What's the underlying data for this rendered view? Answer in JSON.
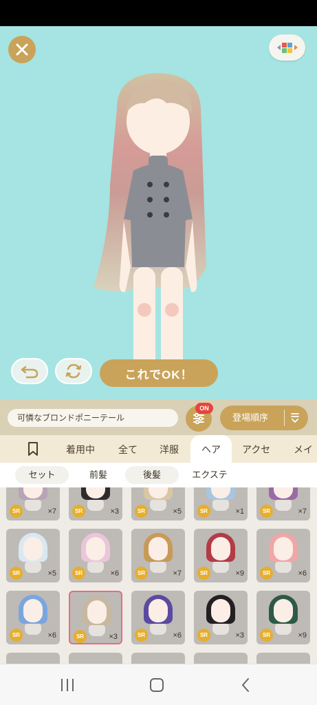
{
  "buttons": {
    "ok_label": "これでOK！"
  },
  "item_name": "可憐なブロンドポニーテール",
  "filter_badge": "ON",
  "sort_label": "登場順序",
  "tabs": [
    "着用中",
    "全て",
    "洋服",
    "ヘア",
    "アクセ",
    "メイ"
  ],
  "active_tab": "ヘア",
  "subtabs": [
    "セット",
    "前髪",
    "後髪",
    "エクステ"
  ],
  "items": [
    {
      "rarity": "SR",
      "qty": "×7",
      "hair": "#b9a3b6",
      "icon": "hair-item-icon"
    },
    {
      "rarity": "SR",
      "qty": "×3",
      "hair": "#2e2a2e",
      "icon": "hair-item-icon"
    },
    {
      "rarity": "SR",
      "qty": "×5",
      "hair": "#d9c7a4",
      "icon": "hair-item-icon"
    },
    {
      "rarity": "SR",
      "qty": "×1",
      "hair": "#a9c6e0",
      "icon": "hair-item-icon"
    },
    {
      "rarity": "SR",
      "qty": "×7",
      "hair": "#9a6aa6",
      "icon": "hair-item-icon"
    },
    {
      "rarity": "SR",
      "qty": "×5",
      "hair": "#dbe8f2",
      "icon": "hair-item-icon"
    },
    {
      "rarity": "SR",
      "qty": "×6",
      "hair": "#eac6d8",
      "icon": "hair-item-icon"
    },
    {
      "rarity": "SR",
      "qty": "×7",
      "hair": "#c89a58",
      "icon": "hair-item-icon"
    },
    {
      "rarity": "SR",
      "qty": "×9",
      "hair": "#b23c46",
      "icon": "hair-item-icon"
    },
    {
      "rarity": "SR",
      "qty": "×6",
      "hair": "#f0a6a6",
      "icon": "hair-item-icon"
    },
    {
      "rarity": "SR",
      "qty": "×6",
      "hair": "#7aa6e0",
      "icon": "hair-item-icon"
    },
    {
      "rarity": "SR",
      "qty": "×3",
      "hair": "#c8b8a0",
      "icon": "hair-item-icon",
      "selected": true
    },
    {
      "rarity": "SR",
      "qty": "×6",
      "hair": "#5a4aa0",
      "icon": "hair-item-icon"
    },
    {
      "rarity": "SR",
      "qty": "×3",
      "hair": "#231f22",
      "icon": "hair-item-icon"
    },
    {
      "rarity": "SR",
      "qty": "×9",
      "hair": "#2c5a46",
      "icon": "hair-item-icon"
    }
  ],
  "colors": {
    "accent": "#c9a35a",
    "stage_bg": "#a5e4e2",
    "badge_red": "#e5453c",
    "rarity_gold": "#e6ae2c",
    "selected_border": "#ea6a80"
  }
}
